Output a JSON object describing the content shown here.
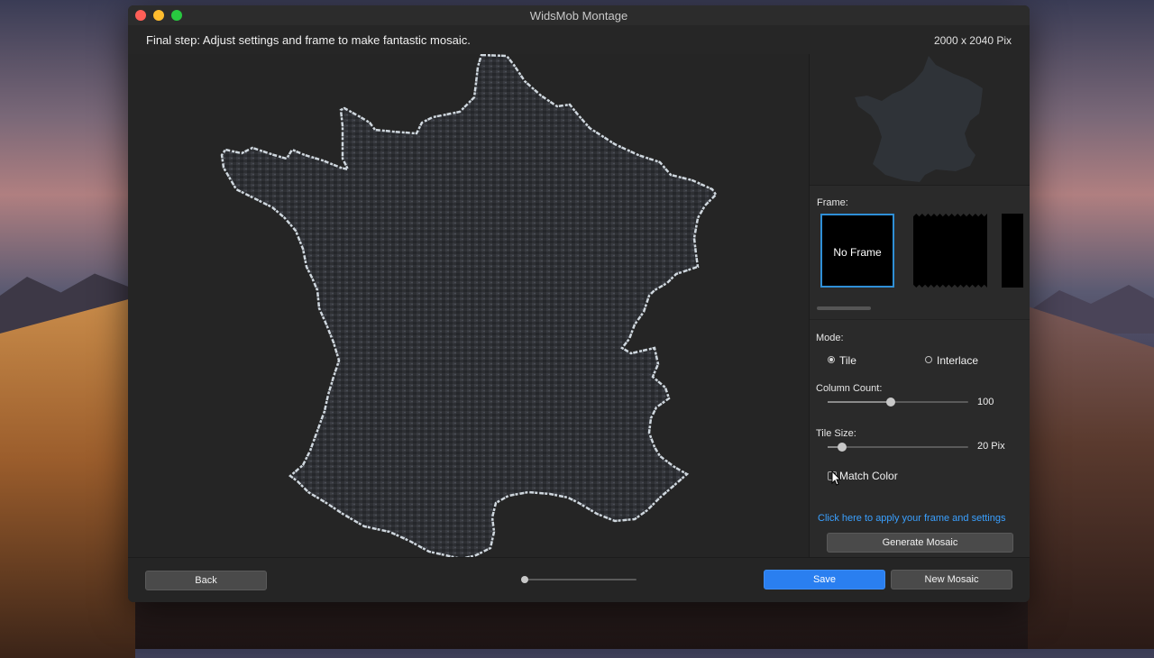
{
  "window": {
    "title": "WidsMob Montage"
  },
  "header": {
    "instruction": "Final step: Adjust settings and frame to make fantastic mosaic.",
    "dimensions": "2000 x 2040 Pix"
  },
  "sidebar": {
    "frame_label": "Frame:",
    "frames": [
      {
        "label": "No Frame",
        "selected": true
      },
      {
        "label": "",
        "selected": false
      },
      {
        "label": "",
        "selected": false
      }
    ],
    "mode_label": "Mode:",
    "mode_options": [
      {
        "label": "Tile",
        "selected": true
      },
      {
        "label": "Interlace",
        "selected": false
      }
    ],
    "column_count": {
      "label": "Column Count:",
      "value": "100",
      "level": 0.45
    },
    "tile_size": {
      "label": "Tile Size:",
      "value": "20 Pix",
      "level": 0.1
    },
    "match_color": {
      "label": "Match Color",
      "checked": false
    },
    "apply_link": "Click here to apply your frame and settings",
    "generate_button": "Generate Mosaic"
  },
  "footer": {
    "back_button": "Back",
    "zoom_level": 0.0,
    "save_button": "Save",
    "new_mosaic_button": "New Mosaic"
  },
  "colors": {
    "accent": "#2a7ff0",
    "link": "#3aa0ff",
    "frame_selected_border": "#2f8fd6"
  }
}
